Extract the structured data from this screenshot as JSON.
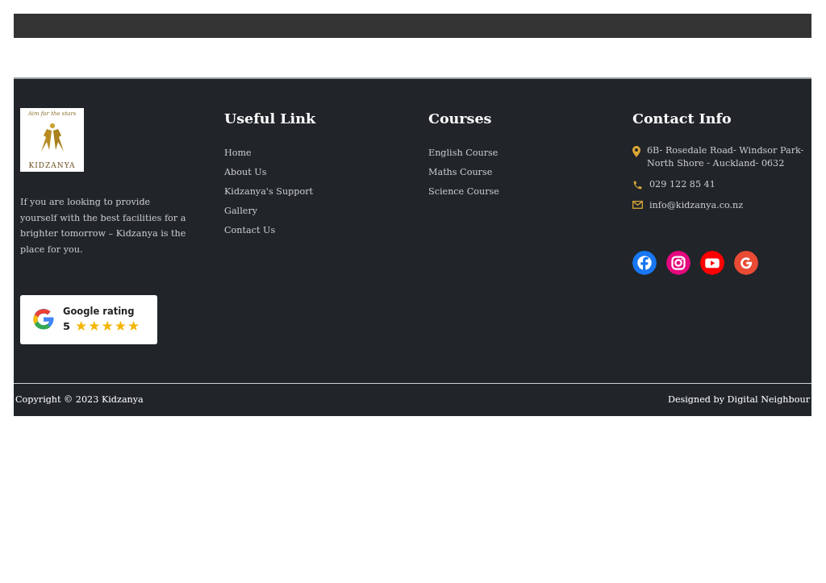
{
  "logo": {
    "tagline": "Aim for the stars",
    "wordmark": "KIDZANYA"
  },
  "about": {
    "text": "If you are looking to provide yourself with the best facilities for a brighter tomorrow – Kidzanya is the place for you."
  },
  "rating_badge": {
    "label": "Google rating",
    "score": "5",
    "stars": 5
  },
  "columns": [
    {
      "title": "Useful Link",
      "links": [
        "Home",
        "About Us",
        "Kidzanya's Support",
        "Gallery",
        "Contact Us"
      ]
    },
    {
      "title": "Courses",
      "links": [
        "English Course",
        "Maths Course",
        "Science Course"
      ]
    }
  ],
  "contact": {
    "title": "Contact Info",
    "items": [
      {
        "kind": "address",
        "text": "6B- Rosedale Road- Windsor Park- North Shore - Auckland- 0632"
      },
      {
        "kind": "phone",
        "text": "029 122 85 41"
      },
      {
        "kind": "email",
        "text": "info@kidzanya.co.nz"
      }
    ],
    "social": [
      {
        "kind": "facebook",
        "color": "#1877f2"
      },
      {
        "kind": "instagram",
        "color": "#e4097e"
      },
      {
        "kind": "youtube",
        "color": "#ff0000"
      },
      {
        "kind": "google",
        "color": "#e94b35"
      }
    ]
  },
  "bottom_bar": {
    "copyright": "Copyright © 2023 Kidzanya",
    "credit": "Designed by Digital Neighbour"
  }
}
